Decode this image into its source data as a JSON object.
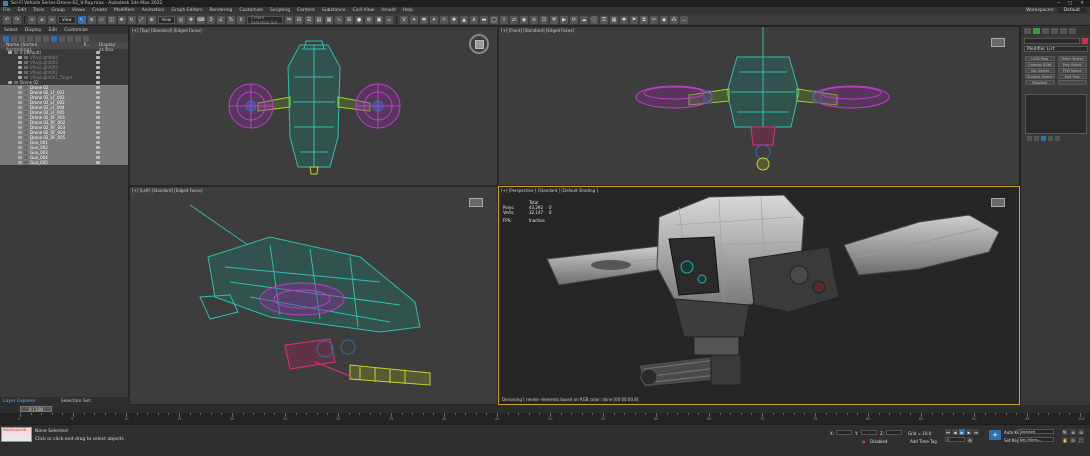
{
  "window": {
    "title": "Sci-Fi Vehicle Series-Drone-02_V-Ray.max - Autodesk 3ds Max 2022"
  },
  "menu": {
    "items": [
      "File",
      "Edit",
      "Tools",
      "Group",
      "Views",
      "Create",
      "Modifiers",
      "Animation",
      "Graph Editors",
      "Rendering",
      "Customize",
      "Scripting",
      "Content",
      "Substance",
      "Civil View",
      "Arnold",
      "Help"
    ],
    "workspaces_label": "Workspaces:",
    "workspace_value": "Default"
  },
  "toolbar": {
    "filter_select": "View",
    "selection_set_placeholder": "Create Selection Set"
  },
  "scene_explorer": {
    "tabs": [
      "Select",
      "Display",
      "Edit",
      "Customize"
    ],
    "columns": [
      "Name (Sorted Ascending)",
      "R...",
      "Display as Box"
    ],
    "rows": [
      {
        "name": "0 (default)",
        "indent": 0,
        "state": "normal"
      },
      {
        "name": "VRayLight004",
        "indent": 1,
        "state": "dim"
      },
      {
        "name": "VRayLight002",
        "indent": 1,
        "state": "dim"
      },
      {
        "name": "VRayLight005",
        "indent": 1,
        "state": "dim"
      },
      {
        "name": "VRayLight001",
        "indent": 1,
        "state": "dim"
      },
      {
        "name": "VRayLight001_Target",
        "indent": 1,
        "state": "dim"
      },
      {
        "name": "Drone 02",
        "indent": 0,
        "state": "normal"
      },
      {
        "name": "Drone 02",
        "indent": 1,
        "state": "selected"
      },
      {
        "name": "Drone 02_LF_001",
        "indent": 1,
        "state": "selected"
      },
      {
        "name": "Drone 02_LF_002",
        "indent": 1,
        "state": "selected"
      },
      {
        "name": "Drone 02_LF_003",
        "indent": 1,
        "state": "selected"
      },
      {
        "name": "Drone 02_LF_004",
        "indent": 1,
        "state": "selected"
      },
      {
        "name": "Drone 02_LF_005",
        "indent": 1,
        "state": "selected"
      },
      {
        "name": "Drone 02_RF_001",
        "indent": 1,
        "state": "selected"
      },
      {
        "name": "Drone 02_RF_002",
        "indent": 1,
        "state": "selected"
      },
      {
        "name": "Drone 02_RF_003",
        "indent": 1,
        "state": "selected"
      },
      {
        "name": "Drone 02_RF_004",
        "indent": 1,
        "state": "selected"
      },
      {
        "name": "Drone 02_RF_005",
        "indent": 1,
        "state": "selected"
      },
      {
        "name": "Gun_001",
        "indent": 1,
        "state": "selected"
      },
      {
        "name": "Gun_002",
        "indent": 1,
        "state": "selected"
      },
      {
        "name": "Gun_003",
        "indent": 1,
        "state": "selected"
      },
      {
        "name": "Gun_004",
        "indent": 1,
        "state": "selected"
      },
      {
        "name": "Gun_005",
        "indent": 1,
        "state": "selected"
      }
    ],
    "layer_explorer_label": "Layer Explorer",
    "selection_set_label": "Selection Set:"
  },
  "viewports": {
    "top": {
      "label": "[+] [Top] [Standard] [Edged Faces]"
    },
    "front": {
      "label": "[+] [Front] [Standard] [Edged Faces]"
    },
    "left": {
      "label": "[+] [Left] [Standard] [Edged Faces]"
    },
    "perspective": {
      "label": "[+] [Perspective ] [Standard ] [Default Shading ]",
      "stats": {
        "total_label": "Total",
        "polys_label": "Polys:",
        "polys_value": "43,292",
        "polys_sel": "0",
        "verts_label": "Verts:",
        "verts_value": "32,147",
        "verts_sel": "0",
        "fps_label": "FPS:",
        "fps_value": "Inactive"
      },
      "footer": "Denoising [ render elements based on RGB color: done [00:00:00.8]"
    }
  },
  "command_panel": {
    "modifier_list_label": "Modifier List",
    "buttons": [
      "UVW Map",
      "Patch Select",
      "Unwrap UVW",
      "Poly Select",
      "Vol. Select",
      "FFD Select",
      "Surface Select",
      "Edit Poly",
      "Displace",
      ""
    ],
    "accent_color": "#c8344c"
  },
  "timeline": {
    "frame_display": "0 / 100",
    "ticks": [
      "0",
      "5",
      "10",
      "15",
      "20",
      "25",
      "30",
      "35",
      "40",
      "45",
      "50",
      "55",
      "60",
      "65",
      "70",
      "75",
      "80",
      "85",
      "90",
      "95",
      "100"
    ]
  },
  "status": {
    "maxscript_text": "MAXScript Mi...",
    "selected_text": "None Selected",
    "prompt_text": "Click or click-and-drag to select objects",
    "x_label": "X:",
    "y_label": "Y:",
    "z_label": "Z:",
    "grid_label": "Grid = 10.0",
    "disabled_label": "Disabled",
    "add_time_tag": "Add Time Tag",
    "auto_key": "Auto Key",
    "selected_mode": "Selected",
    "set_key": "Set Key",
    "key_filters": "Key Filters...",
    "frame_value": "0"
  },
  "colors": {
    "accent_blue": "#2c6fb3",
    "active_viewport_border": "#c9a227",
    "teal_wire": "#2bbfae",
    "magenta_wire": "#c03ad0",
    "yellow_wire": "#c8d22a"
  }
}
